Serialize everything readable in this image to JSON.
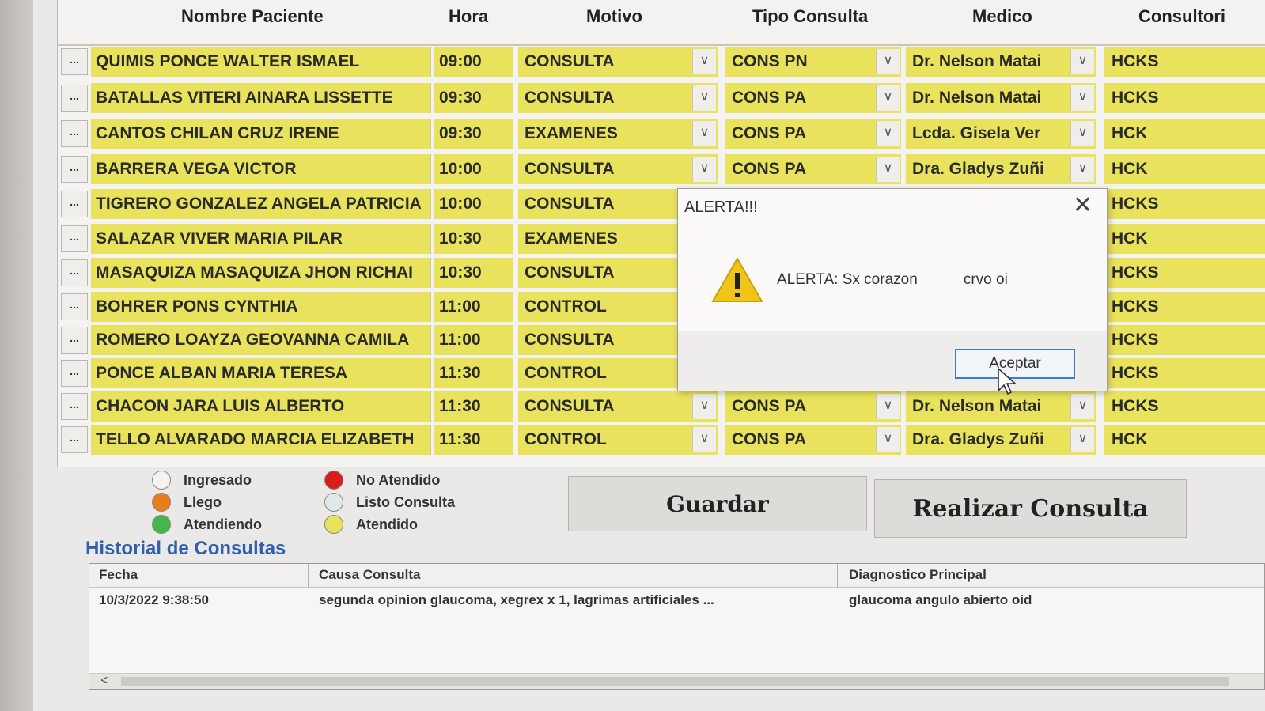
{
  "grid": {
    "headers": {
      "nombre": "Nombre Paciente",
      "hora": "Hora",
      "motivo": "Motivo",
      "tipo": "Tipo Consulta",
      "medico": "Medico",
      "consultorio": "Consultori"
    },
    "rows": [
      {
        "btn": "...",
        "nombre": "QUIMIS PONCE WALTER ISMAEL",
        "hora": "09:00",
        "motivo": "CONSULTA",
        "tipo": "CONS PN",
        "medico": "Dr. Nelson Matai",
        "consultorio": "HCKS"
      },
      {
        "btn": "...",
        "nombre": "BATALLAS VITERI AINARA LISSETTE",
        "hora": "09:30",
        "motivo": "CONSULTA",
        "tipo": "CONS PA",
        "medico": "Dr. Nelson Matai",
        "consultorio": "HCKS"
      },
      {
        "btn": "...",
        "nombre": "CANTOS CHILAN CRUZ IRENE",
        "hora": "09:30",
        "motivo": "EXAMENES",
        "tipo": "CONS PA",
        "medico": "Lcda. Gisela Ver",
        "consultorio": "HCK"
      },
      {
        "btn": "...",
        "nombre": "BARRERA VEGA VICTOR",
        "hora": "10:00",
        "motivo": "CONSULTA",
        "tipo": "CONS PA",
        "medico": "Dra. Gladys Zuñi",
        "consultorio": "HCK"
      },
      {
        "btn": "...",
        "nombre": "TIGRERO GONZALEZ ANGELA PATRICIA",
        "hora": "10:00",
        "motivo": "CONSULTA",
        "tipo": "",
        "medico": "",
        "consultorio": "HCKS"
      },
      {
        "btn": "...",
        "nombre": "SALAZAR VIVER MARIA PILAR",
        "hora": "10:30",
        "motivo": "EXAMENES",
        "tipo": "",
        "medico": "",
        "consultorio": "HCK"
      },
      {
        "btn": "...",
        "nombre": "MASAQUIZA MASAQUIZA JHON RICHAI",
        "hora": "10:30",
        "motivo": "CONSULTA",
        "tipo": "",
        "medico": "",
        "consultorio": "HCKS"
      },
      {
        "btn": "...",
        "nombre": "BOHRER PONS CYNTHIA",
        "hora": "11:00",
        "motivo": "CONTROL",
        "tipo": "",
        "medico": "",
        "consultorio": "HCKS"
      },
      {
        "btn": "...",
        "nombre": "ROMERO LOAYZA GEOVANNA CAMILA",
        "hora": "11:00",
        "motivo": "CONSULTA",
        "tipo": "",
        "medico": "",
        "consultorio": "HCKS"
      },
      {
        "btn": "...",
        "nombre": "PONCE ALBAN MARIA TERESA",
        "hora": "11:30",
        "motivo": "CONTROL",
        "tipo": "",
        "medico": "",
        "consultorio": "HCKS"
      },
      {
        "btn": "...",
        "nombre": "CHACON JARA LUIS ALBERTO",
        "hora": "11:30",
        "motivo": "CONSULTA",
        "tipo": "CONS PA",
        "medico": "Dr. Nelson Matai",
        "consultorio": "HCKS"
      },
      {
        "btn": "...",
        "nombre": "TELLO ALVARADO MARCIA ELIZABETH",
        "hora": "11:30",
        "motivo": "CONTROL",
        "tipo": "CONS PA",
        "medico": "Dra. Gladys Zuñi",
        "consultorio": "HCK"
      }
    ]
  },
  "legend": [
    {
      "label": "Ingresado",
      "color": "#f4f3f1"
    },
    {
      "label": "Llego",
      "color": "#e67e1e"
    },
    {
      "label": "Atendiendo",
      "color": "#45b649"
    },
    {
      "label": "No Atendido",
      "color": "#d91c1c"
    },
    {
      "label": "Listo Consulta",
      "color": "#dfe9ea"
    },
    {
      "label": "Atendido",
      "color": "#e8e25d"
    }
  ],
  "buttons": {
    "guardar": "Guardar",
    "realizar": "Realizar Consulta"
  },
  "historial": {
    "title": "Historial de Consultas",
    "headers": {
      "fecha": "Fecha",
      "causa": "Causa Consulta",
      "diagnostico": "Diagnostico Principal"
    },
    "rows": [
      {
        "fecha": "10/3/2022 9:38:50",
        "causa": "segunda opinion glaucoma, xegrex x 1, lagrimas artificiales ...",
        "diagnostico": "glaucoma angulo abierto oid"
      }
    ],
    "scroll_left": "<"
  },
  "dialog": {
    "title": "ALERTA!!!",
    "close": "✕",
    "message": "ALERTA: Sx corazon           crvo oi",
    "ok": "Aceptar"
  },
  "icons": {
    "dropdown": "chevron-down-icon",
    "warning": "warning-icon",
    "close": "close-icon",
    "cursor": "mouse-cursor-icon"
  }
}
